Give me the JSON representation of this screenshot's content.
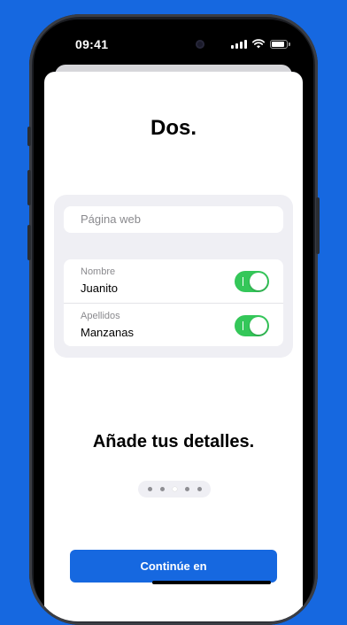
{
  "status_bar": {
    "time": "09:41"
  },
  "screen": {
    "title": "Dos.",
    "web_field": {
      "placeholder": "Página web"
    },
    "rows": [
      {
        "label": "Nombre",
        "value": "Juanito",
        "enabled": true
      },
      {
        "label": "Apellidos",
        "value": "Manzanas",
        "enabled": true
      }
    ],
    "subtitle": "Añade tus detalles.",
    "pager": {
      "pages": 5,
      "current_page": 3
    },
    "cta_label": "Continúe en"
  },
  "colors": {
    "background": "#1668e0",
    "accent": "#1668e0",
    "toggle_on": "#34c759",
    "card_bg": "#efeff4"
  }
}
